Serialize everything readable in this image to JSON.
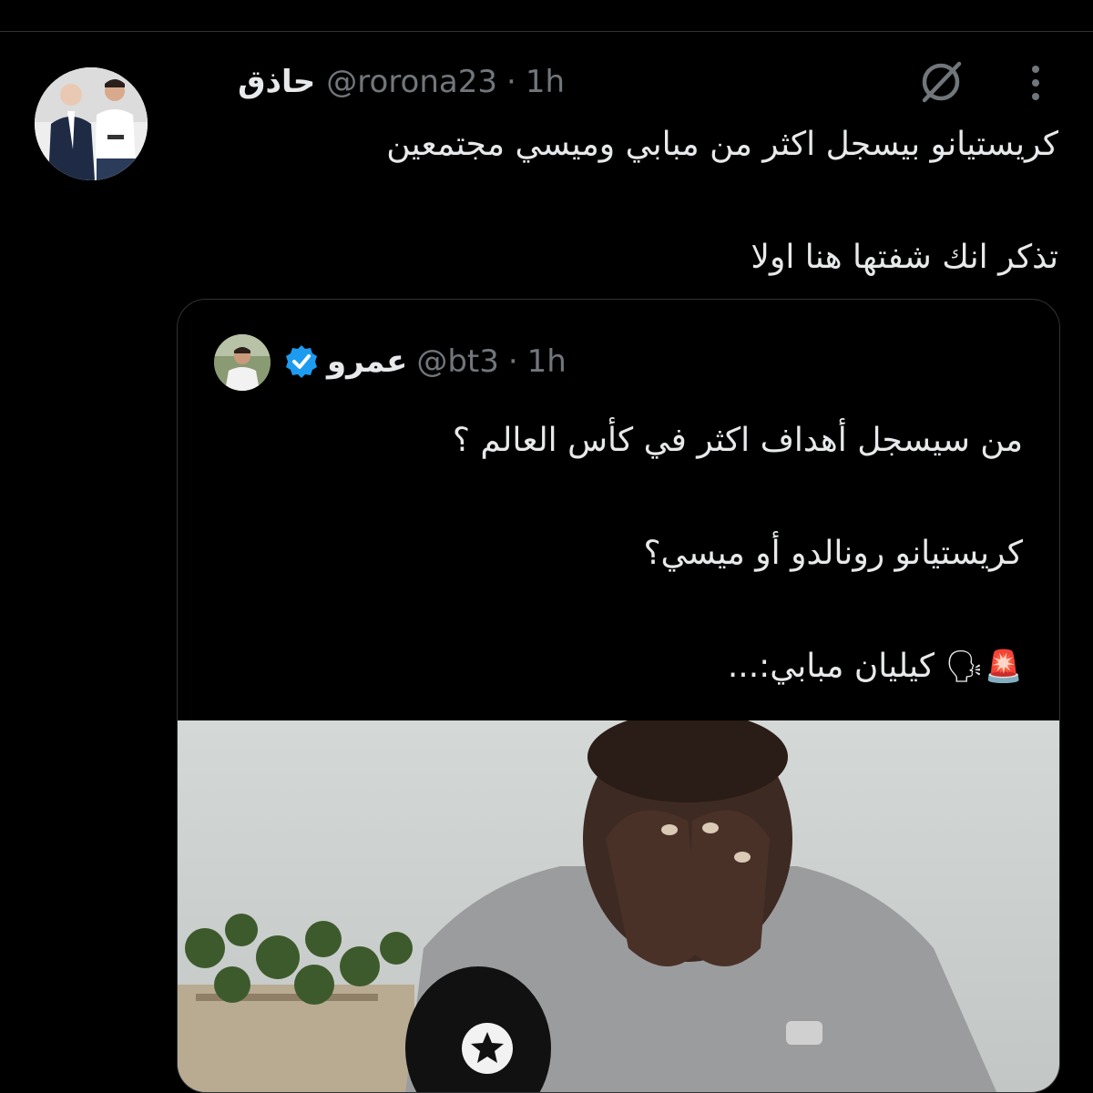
{
  "tweet": {
    "name": "حاذق",
    "handle": "@rorona23",
    "dot": "·",
    "time": "1h",
    "line1": "كريستيانو بيسجل اكثر من مبابي وميسي مجتمعين",
    "line2": "تذكر انك شفتها هنا اولا"
  },
  "quote": {
    "name": "عمرو",
    "handle": "@bt3",
    "dot": "·",
    "time": "1h",
    "line1": "من سيسجل أهداف اكثر في كأس العالم ؟",
    "line2": "كريستيانو رونالدو أو ميسي؟",
    "line3_text": "كيليان مبابي:...",
    "line3_emojis": "🚨🗣"
  },
  "icons": [
    "grok-icon",
    "more-icon",
    "verified-badge-icon"
  ],
  "colors": {
    "background": "#000000",
    "text": "#e7e9ea",
    "muted": "#71767b",
    "border": "#2f3336",
    "verified": "#1d9bf0"
  }
}
